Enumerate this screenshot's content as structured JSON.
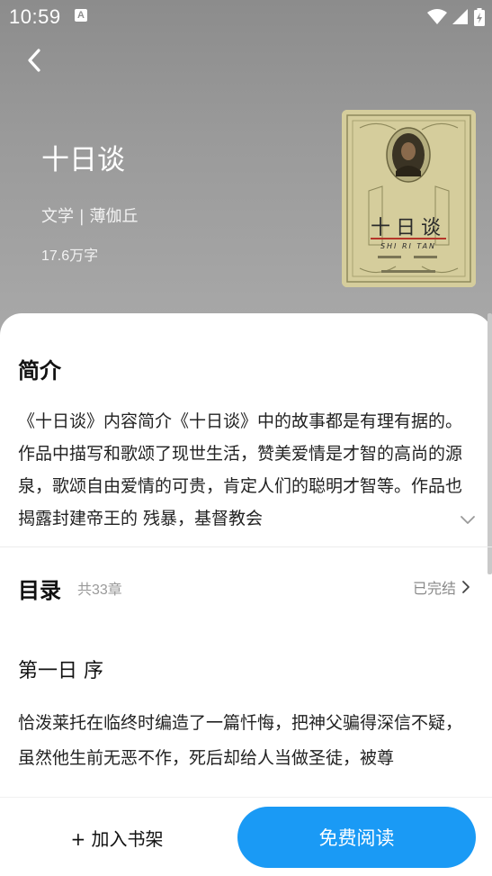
{
  "status_bar": {
    "time": "10:59",
    "notification_badge": "A"
  },
  "book": {
    "title": "十日谈",
    "meta": "文学 | 薄伽丘",
    "word_count": "17.6万字",
    "cover": {
      "title": "十日谈",
      "pinyin": "SHI RI TAN"
    }
  },
  "intro": {
    "heading": "简介",
    "text": "《十日谈》内容简介《十日谈》中的故事都是有理有据的。作品中描写和歌颂了现世生活，赞美爱情是才智的高尚的源泉，歌颂自由爱情的可贵，肯定人们的聪明才智等。作品也揭露封建帝王的 残暴，基督教会"
  },
  "toc": {
    "heading": "目录",
    "count": "共33章",
    "status": "已完结"
  },
  "chapter": {
    "title": "第一日 序",
    "text": "恰泼莱托在临终时编造了一篇忏悔，把神父骗得深信不疑，虽然他生前无恶不作，死后却给人当做圣徒，被尊"
  },
  "actions": {
    "add_to_shelf": "+ 加入书架",
    "free_read": "免费阅读"
  }
}
